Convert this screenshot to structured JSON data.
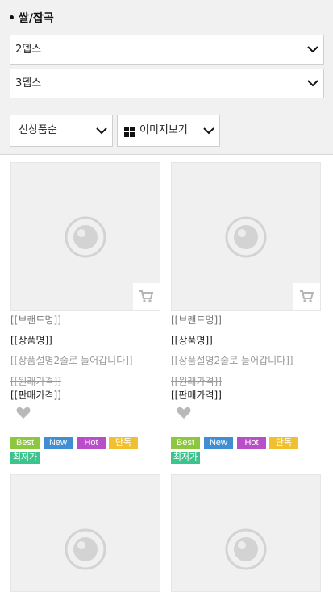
{
  "category": {
    "title": "쌀/잡곡"
  },
  "filters": {
    "depth2": "2뎁스",
    "depth3": "3뎁스"
  },
  "sort": {
    "order_label": "신상품순",
    "view_label": "이미지보기"
  },
  "products": [
    {
      "brand": "[[브랜드명]]",
      "name": "[[상품명]]",
      "desc": "[[상품설명2줄로 들어갑니다]]",
      "original_price": "[[원래가격]]",
      "sale_price": "[[판매가격]]",
      "badges": [
        {
          "label": "Best",
          "color": "#8dc63f"
        },
        {
          "label": "New",
          "color": "#3f8fd2"
        },
        {
          "label": "Hot",
          "color": "#b94fc8"
        },
        {
          "label": "단독",
          "color": "#f0c030"
        },
        {
          "label": "최저가",
          "color": "#3cc48d"
        }
      ]
    },
    {
      "brand": "[[브랜드명]]",
      "name": "[[상품명]]",
      "desc": "[[상품설명2줄로 들어갑니다]]",
      "original_price": "[[원래가격]]",
      "sale_price": "[[판매가격]]",
      "badges": [
        {
          "label": "Best",
          "color": "#8dc63f"
        },
        {
          "label": "New",
          "color": "#3f8fd2"
        },
        {
          "label": "Hot",
          "color": "#b94fc8"
        },
        {
          "label": "단독",
          "color": "#f0c030"
        },
        {
          "label": "최저가",
          "color": "#3cc48d"
        }
      ]
    }
  ],
  "icons": {
    "chevron": "chevron-down-icon",
    "grid": "grid-view-icon",
    "cart": "cart-icon",
    "heart": "heart-icon",
    "placeholder": "image-placeholder-icon"
  }
}
